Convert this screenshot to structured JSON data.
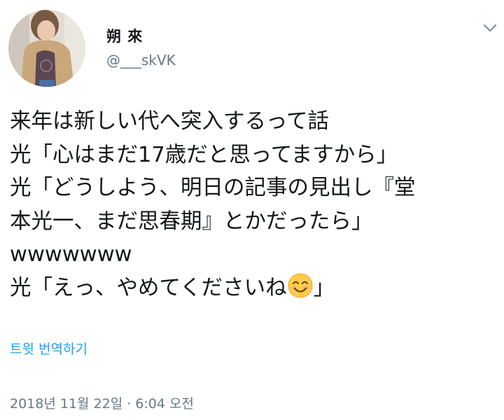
{
  "author": {
    "display_name": "朔 來",
    "handle": "@___skVK"
  },
  "tweet": {
    "lines": [
      "来年は新しい代へ突入するって話",
      "光「心はまだ17歳だと思ってますから」",
      "光「どうしよう、明日の記事の見出し『堂",
      "本光一、まだ思春期』とかだったら」",
      "wwwwwww"
    ],
    "last_line_before_emoji": "光「えっ、やめてくださいね",
    "emoji": "smiling-face-emoji",
    "last_line_after_emoji": "」"
  },
  "translate_label": "트윗 번역하기",
  "timestamp": "2018년 11월 22일 · 6:04 오전",
  "colors": {
    "link": "#1da1f2",
    "muted": "#657786",
    "text": "#14171a"
  }
}
